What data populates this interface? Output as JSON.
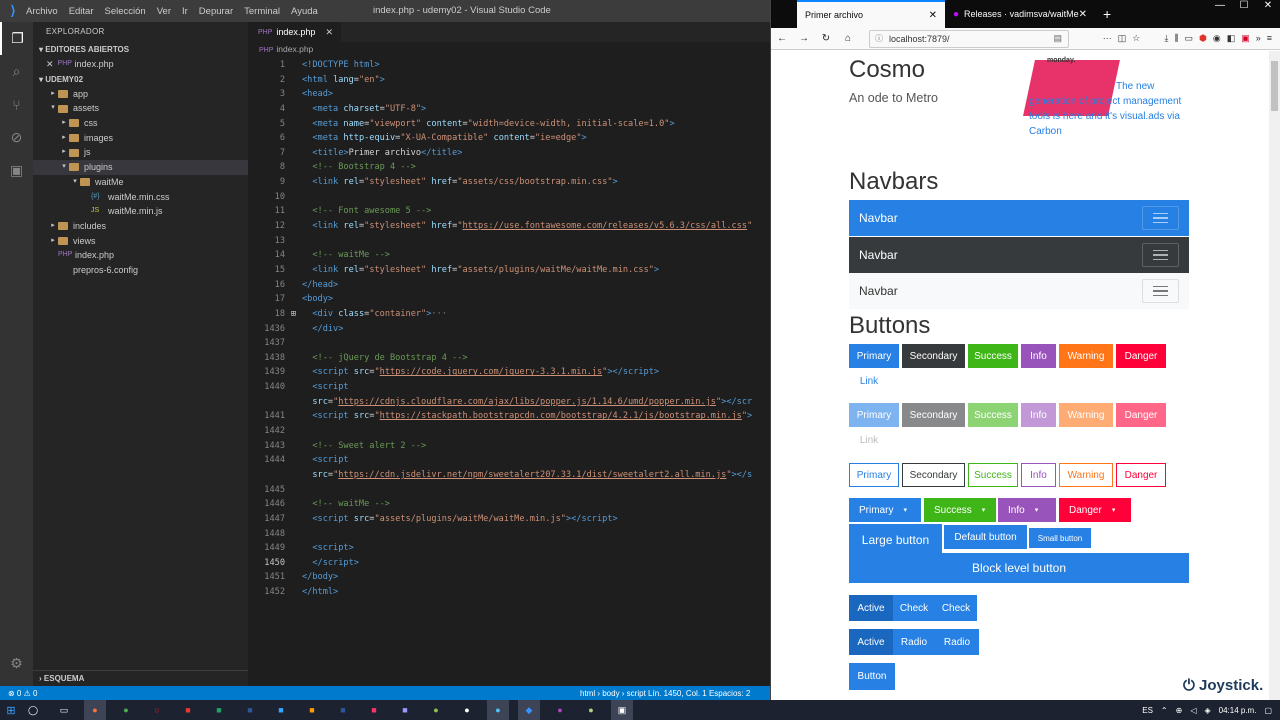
{
  "vscode": {
    "menu": [
      "Archivo",
      "Editar",
      "Selección",
      "Ver",
      "Ir",
      "Depurar",
      "Terminal",
      "Ayuda"
    ],
    "window_title": "index.php - udemy02 - Visual Studio Code",
    "explorer_header": "EXPLORADOR",
    "open_editors_header": "EDITORES ABIERTOS",
    "open_file": "index.php",
    "project_header": "UDEMY02",
    "tree": [
      {
        "label": "app",
        "indent": 1,
        "twisty": "▸",
        "type": "folder"
      },
      {
        "label": "assets",
        "indent": 1,
        "twisty": "▾",
        "type": "folder"
      },
      {
        "label": "css",
        "indent": 2,
        "twisty": "▸",
        "type": "folder"
      },
      {
        "label": "images",
        "indent": 2,
        "twisty": "▸",
        "type": "folder"
      },
      {
        "label": "js",
        "indent": 2,
        "twisty": "▸",
        "type": "folder"
      },
      {
        "label": "plugins",
        "indent": 2,
        "twisty": "▾",
        "type": "folder",
        "selected": true
      },
      {
        "label": "waitMe",
        "indent": 3,
        "twisty": "▾",
        "type": "folder"
      },
      {
        "label": "waitMe.min.css",
        "indent": 4,
        "twisty": "",
        "type": "css"
      },
      {
        "label": "waitMe.min.js",
        "indent": 4,
        "twisty": "",
        "type": "js"
      },
      {
        "label": "includes",
        "indent": 1,
        "twisty": "▸",
        "type": "folder"
      },
      {
        "label": "views",
        "indent": 1,
        "twisty": "▸",
        "type": "folder"
      },
      {
        "label": "index.php",
        "indent": 1,
        "twisty": "",
        "type": "php"
      },
      {
        "label": "prepros-6.config",
        "indent": 1,
        "twisty": "",
        "type": "file"
      }
    ],
    "outline_header": "ESQUEMA",
    "tab_label": "index.php",
    "breadcrumb": "index.php",
    "status_left": "⊗ 0  ⚠ 0",
    "status_right": "html › body › script     Lín. 1450, Col. 1    Espacios: 2",
    "code_lines": [
      {
        "n": "1",
        "g": "",
        "h": "<span class='tg'>&lt;!DOCTYPE html&gt;</span>"
      },
      {
        "n": "2",
        "g": "",
        "h": "<span class='tg'>&lt;html</span> <span class='at'>lang</span><span class='tx'>=</span><span class='st'>\"en\"</span><span class='tg'>&gt;</span>"
      },
      {
        "n": "3",
        "g": "",
        "h": "<span class='tg'>&lt;head&gt;</span>"
      },
      {
        "n": "4",
        "g": "",
        "h": "  <span class='tg'>&lt;meta</span> <span class='at'>charset</span><span class='tx'>=</span><span class='st'>\"UTF-8\"</span><span class='tg'>&gt;</span>"
      },
      {
        "n": "5",
        "g": "",
        "h": "  <span class='tg'>&lt;meta</span> <span class='at'>name</span><span class='tx'>=</span><span class='st'>\"viewport\"</span> <span class='at'>content</span><span class='tx'>=</span><span class='st'>\"width=device-width, initial-scale=1.0\"</span><span class='tg'>&gt;</span>"
      },
      {
        "n": "6",
        "g": "",
        "h": "  <span class='tg'>&lt;meta</span> <span class='at'>http-equiv</span><span class='tx'>=</span><span class='st'>\"X-UA-Compatible\"</span> <span class='at'>content</span><span class='tx'>=</span><span class='st'>\"ie=edge\"</span><span class='tg'>&gt;</span>"
      },
      {
        "n": "7",
        "g": "",
        "h": "  <span class='tg'>&lt;title&gt;</span><span class='tx'>Primer archivo</span><span class='tg'>&lt;/title&gt;</span>"
      },
      {
        "n": "8",
        "g": "",
        "h": "  <span class='cm'>&lt;!-- Bootstrap 4 --&gt;</span>"
      },
      {
        "n": "9",
        "g": "",
        "h": "  <span class='tg'>&lt;link</span> <span class='at'>rel</span><span class='tx'>=</span><span class='st'>\"stylesheet\"</span> <span class='at'>href</span><span class='tx'>=</span><span class='st'>\"assets/css/bootstrap.min.css\"</span><span class='tg'>&gt;</span>"
      },
      {
        "n": "10",
        "g": "",
        "h": ""
      },
      {
        "n": "11",
        "g": "",
        "h": "  <span class='cm'>&lt;!-- Font awesome 5 --&gt;</span>"
      },
      {
        "n": "12",
        "g": "",
        "h": "  <span class='tg'>&lt;link</span> <span class='at'>rel</span><span class='tx'>=</span><span class='st'>\"stylesheet\"</span> <span class='at'>href</span><span class='tx'>=</span><span class='st'>\"</span><span class='ul'>https://use.fontawesome.com/releases/v5.6.3/css/all.css</span><span class='st'>\"</span>"
      },
      {
        "n": "13",
        "g": "",
        "h": ""
      },
      {
        "n": "14",
        "g": "",
        "h": "  <span class='cm'>&lt;!-- waitMe --&gt;</span>"
      },
      {
        "n": "15",
        "g": "",
        "h": "  <span class='tg'>&lt;link</span> <span class='at'>rel</span><span class='tx'>=</span><span class='st'>\"stylesheet\"</span> <span class='at'>href</span><span class='tx'>=</span><span class='st'>\"assets/plugins/waitMe/waitMe.min.css\"</span><span class='tg'>&gt;</span>"
      },
      {
        "n": "16",
        "g": "",
        "h": "<span class='tg'>&lt;/head&gt;</span>"
      },
      {
        "n": "17",
        "g": "",
        "h": "<span class='tg'>&lt;body&gt;</span>"
      },
      {
        "n": "18",
        "g": "⊞",
        "h": "  <span class='tg'>&lt;div</span> <span class='at'>class</span><span class='tx'>=</span><span class='st'>\"container\"</span><span class='tg'>&gt;</span><span class='pu'>···</span>"
      },
      {
        "n": "1436",
        "g": "",
        "h": "  <span class='tg'>&lt;/div&gt;</span>"
      },
      {
        "n": "1437",
        "g": "",
        "h": ""
      },
      {
        "n": "1438",
        "g": "",
        "h": "  <span class='cm'>&lt;!-- jQuery de Bootstrap 4 --&gt;</span>"
      },
      {
        "n": "1439",
        "g": "",
        "h": "  <span class='tg'>&lt;script</span> <span class='at'>src</span><span class='tx'>=</span><span class='st'>\"</span><span class='ul'>https://code.jquery.com/jquery-3.3.1.min.js</span><span class='st'>\"</span><span class='tg'>&gt;&lt;/script&gt;</span>"
      },
      {
        "n": "1440",
        "g": "",
        "h": "  <span class='tg'>&lt;script</span>"
      },
      {
        "n": "",
        "g": "",
        "h": "  <span class='at'>src</span><span class='tx'>=</span><span class='st'>\"</span><span class='ul'>https://cdnjs.cloudflare.com/ajax/libs/popper.js/1.14.6/umd/popper.min.js</span><span class='st'>\"</span><span class='tg'>&gt;&lt;/scr</span>"
      },
      {
        "n": "1441",
        "g": "",
        "h": "  <span class='tg'>&lt;script</span> <span class='at'>src</span><span class='tx'>=</span><span class='st'>\"</span><span class='ul'>https://stackpath.bootstrapcdn.com/bootstrap/4.2.1/js/bootstrap.min.js</span><span class='st'>\"</span><span class='tg'>&gt;</span>"
      },
      {
        "n": "1442",
        "g": "",
        "h": ""
      },
      {
        "n": "1443",
        "g": "",
        "h": "  <span class='cm'>&lt;!-- Sweet alert 2 --&gt;</span>"
      },
      {
        "n": "1444",
        "g": "",
        "h": "  <span class='tg'>&lt;script</span>"
      },
      {
        "n": "",
        "g": "",
        "h": "  <span class='at'>src</span><span class='tx'>=</span><span class='st'>\"</span><span class='ul'>https://cdn.jsdelivr.net/npm/sweetalert207.33.1/dist/sweetalert2.all.min.js</span><span class='st'>\"</span><span class='tg'>&gt;&lt;/s</span>"
      },
      {
        "n": "1445",
        "g": "",
        "h": ""
      },
      {
        "n": "1446",
        "g": "",
        "h": "  <span class='cm'>&lt;!-- waitMe --&gt;</span>"
      },
      {
        "n": "1447",
        "g": "",
        "h": "  <span class='tg'>&lt;script</span> <span class='at'>src</span><span class='tx'>=</span><span class='st'>\"assets/plugins/waitMe/waitMe.min.js\"</span><span class='tg'>&gt;&lt;/script&gt;</span>"
      },
      {
        "n": "1448",
        "g": "",
        "h": ""
      },
      {
        "n": "1449",
        "g": "",
        "h": "  <span class='tg'>&lt;script&gt;</span>"
      },
      {
        "n": "1450",
        "g": "",
        "h": "  <span class='tg'>&lt;/script&gt;</span>",
        "cur": true
      },
      {
        "n": "1451",
        "g": "",
        "h": "<span class='tg'>&lt;/body&gt;</span>"
      },
      {
        "n": "1452",
        "g": "",
        "h": "<span class='tg'>&lt;/html&gt;</span>"
      }
    ]
  },
  "firefox": {
    "tab1": "Primer archivo",
    "tab2": "Releases · vadimsva/waitMe",
    "url": "localhost:7879/",
    "page": {
      "brand": "Cosmo",
      "subtitle": "An ode to Metro",
      "ad_logo": "monday.",
      "ad_text_first": "The new",
      "ad_text_rest": "generation of project management tools is here and it's visual.ads via Carbon",
      "navbars_title": "Navbars",
      "navbar_label": "Navbar",
      "buttons_title": "Buttons",
      "btn_labels": [
        "Primary",
        "Secondary",
        "Success",
        "Info",
        "Warning",
        "Danger"
      ],
      "link_label": "Link",
      "split": [
        "Primary",
        "Success",
        "Info",
        "Danger"
      ],
      "large": "Large button",
      "default": "Default button",
      "small": "Small button",
      "block": "Block level button",
      "active": "Active",
      "check": "Check",
      "radio": "Radio",
      "button": "Button"
    },
    "colors": {
      "primary": "#2780e3",
      "secondary": "#373a3c",
      "success": "#3fb618",
      "info": "#9954bb",
      "warning": "#ff7518",
      "danger": "#ff0039"
    }
  },
  "taskbar": {
    "lang": "ES",
    "time": "04:14 p.m."
  },
  "watermark": "Joystick."
}
